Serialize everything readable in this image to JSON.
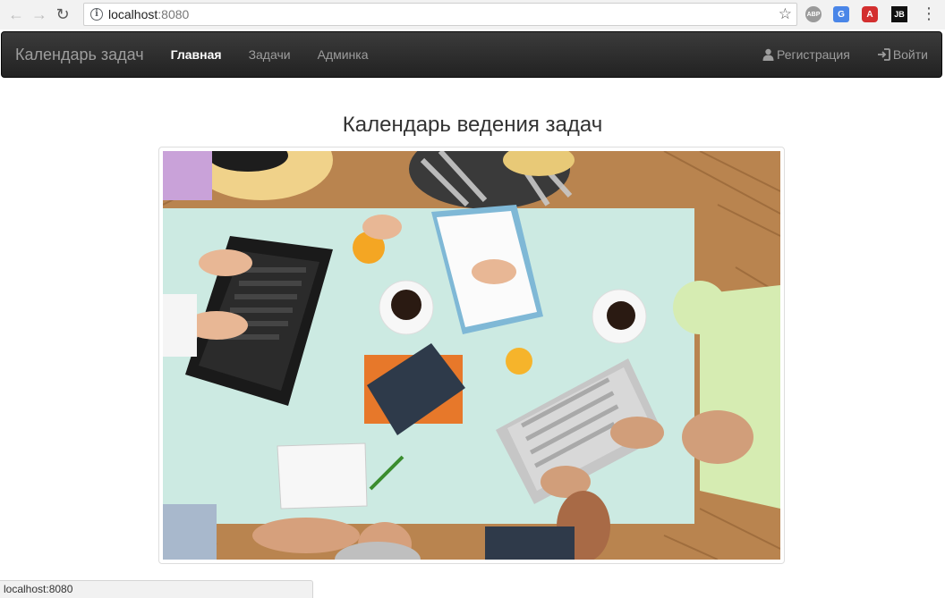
{
  "browser": {
    "url_host": "localhost",
    "url_port": ":8080",
    "status_text": "localhost:8080",
    "extensions": [
      "ABP",
      "G",
      "A",
      "JB"
    ]
  },
  "navbar": {
    "brand": "Календарь задач",
    "links": [
      "Главная",
      "Задачи",
      "Админка"
    ],
    "register": "Регистрация",
    "login": "Войти"
  },
  "main": {
    "title": "Календарь ведения задач",
    "image_alt": "team working at table with laptops"
  },
  "colors": {
    "navbar_bg": "#222222",
    "navbar_text": "#9d9d9d",
    "active_text": "#ffffff"
  }
}
